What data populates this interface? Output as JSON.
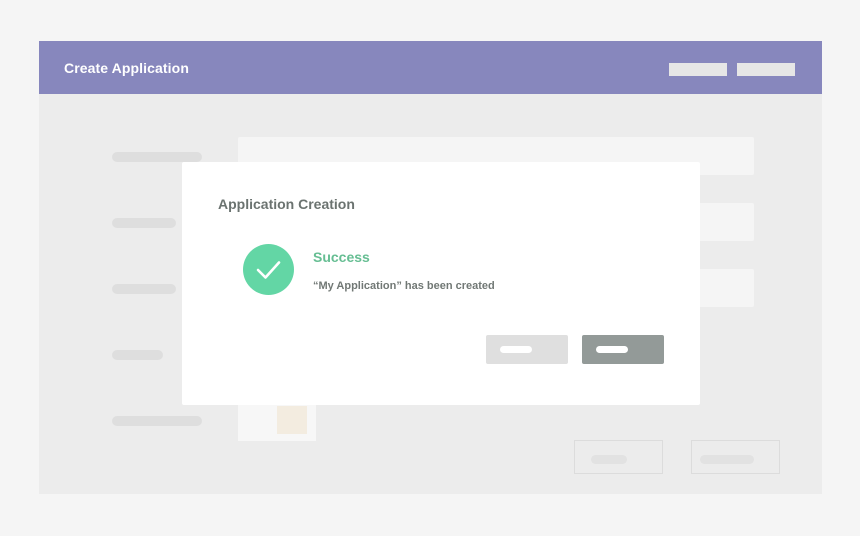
{
  "window": {
    "title": "Create Application",
    "header_actions": [
      "",
      ""
    ]
  },
  "dialog": {
    "title": "Application Creation",
    "status_title": "Success",
    "status_message": "“My Application” has been created",
    "buttons": [
      "",
      ""
    ]
  },
  "colors": {
    "header": "#8787bd",
    "success": "#63d6a5",
    "primary_button": "#939a98",
    "secondary_button": "#dfdfdf"
  },
  "icons": {
    "status": "check-circle-icon"
  }
}
